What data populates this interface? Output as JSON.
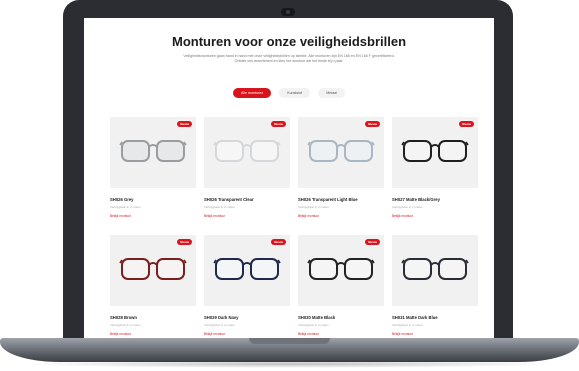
{
  "page": {
    "title": "Monturen voor onze veiligheidsbrillen",
    "intro": "Veiligheidsmonturen gaan hand in hand met onze veiligheidsbrillen op sterkte. Alle monturen zijn EN 166 en EN 166 F gecertificeerd. Ontdek ons assortiment en kies het montuur dat het beste bij u past.",
    "badge_label": "Nieuw",
    "more_link_label": "Bekijk montuur",
    "meta_text": "Verkrijgbaar in 2 maten"
  },
  "filters": [
    {
      "label": "Alle monturen",
      "active": true
    },
    {
      "label": "Kunststof",
      "active": false
    },
    {
      "label": "Metaal",
      "active": false
    }
  ],
  "products": [
    {
      "name": "SH026 Grey",
      "frame_color": "#9a9ca0",
      "lens_tint": "#e7e8ea",
      "badge": true
    },
    {
      "name": "SH026 Transparent Clear",
      "frame_color": "#d6d7da",
      "lens_tint": "#f6f6f7",
      "badge": true
    },
    {
      "name": "SH026 Transparent Light Blue",
      "frame_color": "#a9b7c2",
      "lens_tint": "#eef1f3",
      "badge": true
    },
    {
      "name": "SH027 Matte Black/Grey",
      "frame_color": "#1f1f22",
      "lens_tint": "#f4f4f4",
      "badge": true
    },
    {
      "name": "SH028 Brown",
      "frame_color": "#7a1f1f",
      "lens_tint": "#f6f3f3",
      "badge": true
    },
    {
      "name": "SH029 Dark Navy",
      "frame_color": "#1f2a4a",
      "lens_tint": "#f4f5f7",
      "badge": true
    },
    {
      "name": "SH030 Matte Black",
      "frame_color": "#222224",
      "lens_tint": "#f5f5f5",
      "badge": true
    },
    {
      "name": "SH031 Matte Dark Blue",
      "frame_color": "#2a2d36",
      "lens_tint": "#f5f5f6",
      "badge": false
    }
  ],
  "colors": {
    "accent": "#d9141c",
    "laptop_body": "#2b2d33"
  }
}
